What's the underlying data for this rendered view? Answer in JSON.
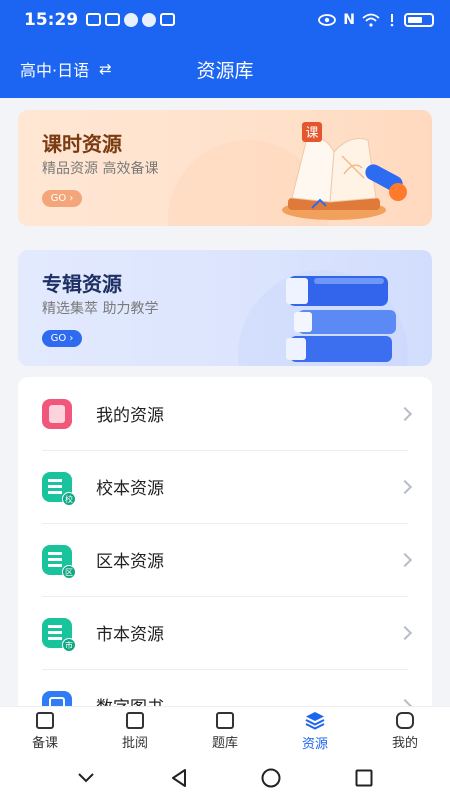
{
  "status_bar": {
    "time": "15:29",
    "nfc": "N"
  },
  "header": {
    "grade": "高中·日语",
    "swap": "⇄",
    "title": "资源库"
  },
  "banners": [
    {
      "title": "课时资源",
      "subtitle": "精品资源   高效备课",
      "go": "GO ›"
    },
    {
      "title": "专辑资源",
      "subtitle": "精选集萃   助力教学",
      "go": "GO ›"
    }
  ],
  "banner_art": {
    "badge": "课"
  },
  "list": [
    {
      "label": "我的资源",
      "icon": "my-resource-icon",
      "color": "#f0577a"
    },
    {
      "label": "校本资源",
      "icon": "school-resource-icon",
      "color": "#19c39b",
      "badge": "校"
    },
    {
      "label": "区本资源",
      "icon": "district-resource-icon",
      "color": "#19c39b",
      "badge": "区"
    },
    {
      "label": "市本资源",
      "icon": "city-resource-icon",
      "color": "#19c39b",
      "badge": "市"
    },
    {
      "label": "数字图书",
      "icon": "digital-book-icon",
      "color": "#2f7cf6"
    }
  ],
  "tabs": [
    {
      "label": "备课",
      "icon": "lesson-prep-icon",
      "active": false
    },
    {
      "label": "批阅",
      "icon": "review-icon",
      "active": false
    },
    {
      "label": "题库",
      "icon": "question-bank-icon",
      "active": false
    },
    {
      "label": "资源",
      "icon": "resource-icon",
      "active": true
    },
    {
      "label": "我的",
      "icon": "profile-icon",
      "active": false
    }
  ],
  "colors": {
    "primary": "#1c64f2",
    "orange_banner": "#ffe4d0",
    "blue_banner": "#dde6fe"
  }
}
